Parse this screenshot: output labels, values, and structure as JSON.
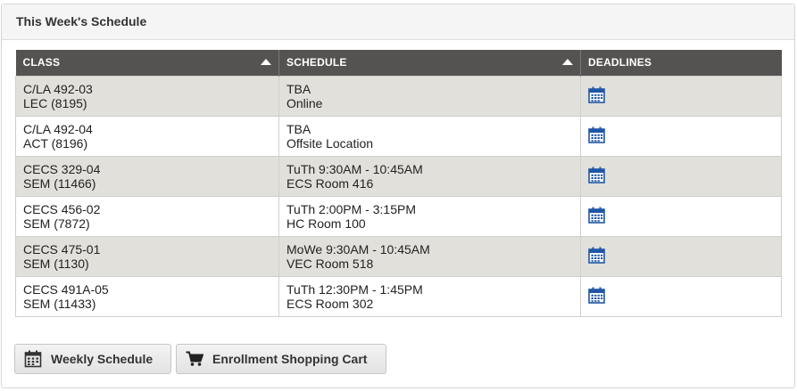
{
  "panel": {
    "title": "This Week's Schedule"
  },
  "table": {
    "headers": {
      "class": "CLASS",
      "schedule": "SCHEDULE",
      "deadlines": "DEADLINES"
    },
    "rows": [
      {
        "class_line1": "C/LA 492-03",
        "class_line2": "LEC (8195)",
        "sched_line1": "TBA",
        "sched_line2": "Online"
      },
      {
        "class_line1": "C/LA 492-04",
        "class_line2": "ACT (8196)",
        "sched_line1": "TBA",
        "sched_line2": "Offsite Location"
      },
      {
        "class_line1": "CECS 329-04",
        "class_line2": "SEM (11466)",
        "sched_line1": "TuTh 9:30AM - 10:45AM",
        "sched_line2": "ECS  Room 416"
      },
      {
        "class_line1": "CECS 456-02",
        "class_line2": "SEM (7872)",
        "sched_line1": "TuTh 2:00PM - 3:15PM",
        "sched_line2": "HC  Room 100"
      },
      {
        "class_line1": "CECS 475-01",
        "class_line2": "SEM (1130)",
        "sched_line1": "MoWe 9:30AM - 10:45AM",
        "sched_line2": "VEC  Room 518"
      },
      {
        "class_line1": "CECS 491A-05",
        "class_line2": "SEM (11433)",
        "sched_line1": "TuTh 12:30PM - 1:45PM",
        "sched_line2": "ECS  Room 302"
      }
    ]
  },
  "buttons": {
    "weekly_schedule": "Weekly Schedule",
    "shopping_cart": "Enrollment Shopping Cart"
  },
  "icons": {
    "deadline": "calendar-icon",
    "weekly": "calendar-icon",
    "cart": "cart-icon"
  },
  "colors": {
    "header_bg": "#545351",
    "odd_row_bg": "#e2e0da",
    "calendar_blue": "#1f57a5"
  }
}
